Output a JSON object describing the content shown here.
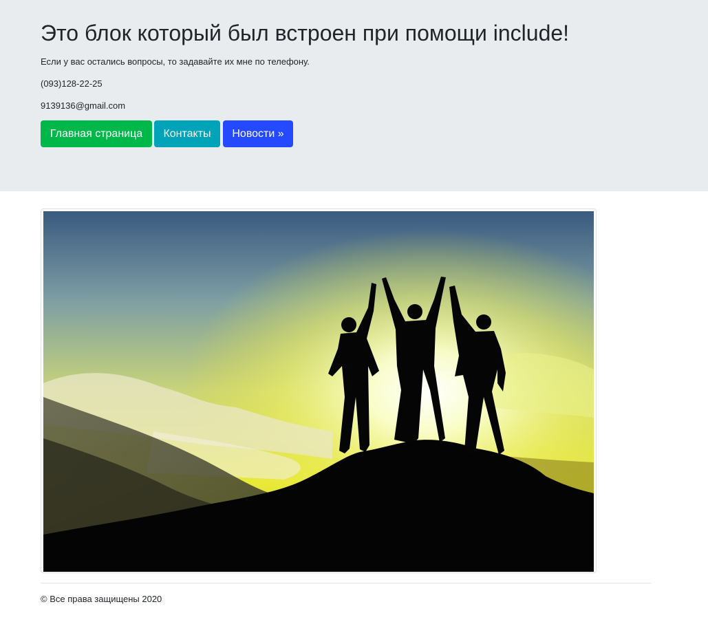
{
  "header": {
    "title": "Это блок который был встроен при помощи include!",
    "subtitle": "Если у вас остались вопросы, то задавайте их мне по телефону.",
    "phone": "(093)128-22-25",
    "email": "9139136@gmail.com"
  },
  "buttons": {
    "home_label": "Главная страница",
    "contacts_label": "Контакты",
    "news_label": "Новости »"
  },
  "colors": {
    "home": "#00b84a",
    "contacts": "#00a3b8",
    "news": "#2449ff",
    "jumbotron_bg": "#e9ecef"
  },
  "footer": {
    "copyright": "© Все права защищены 2020"
  }
}
